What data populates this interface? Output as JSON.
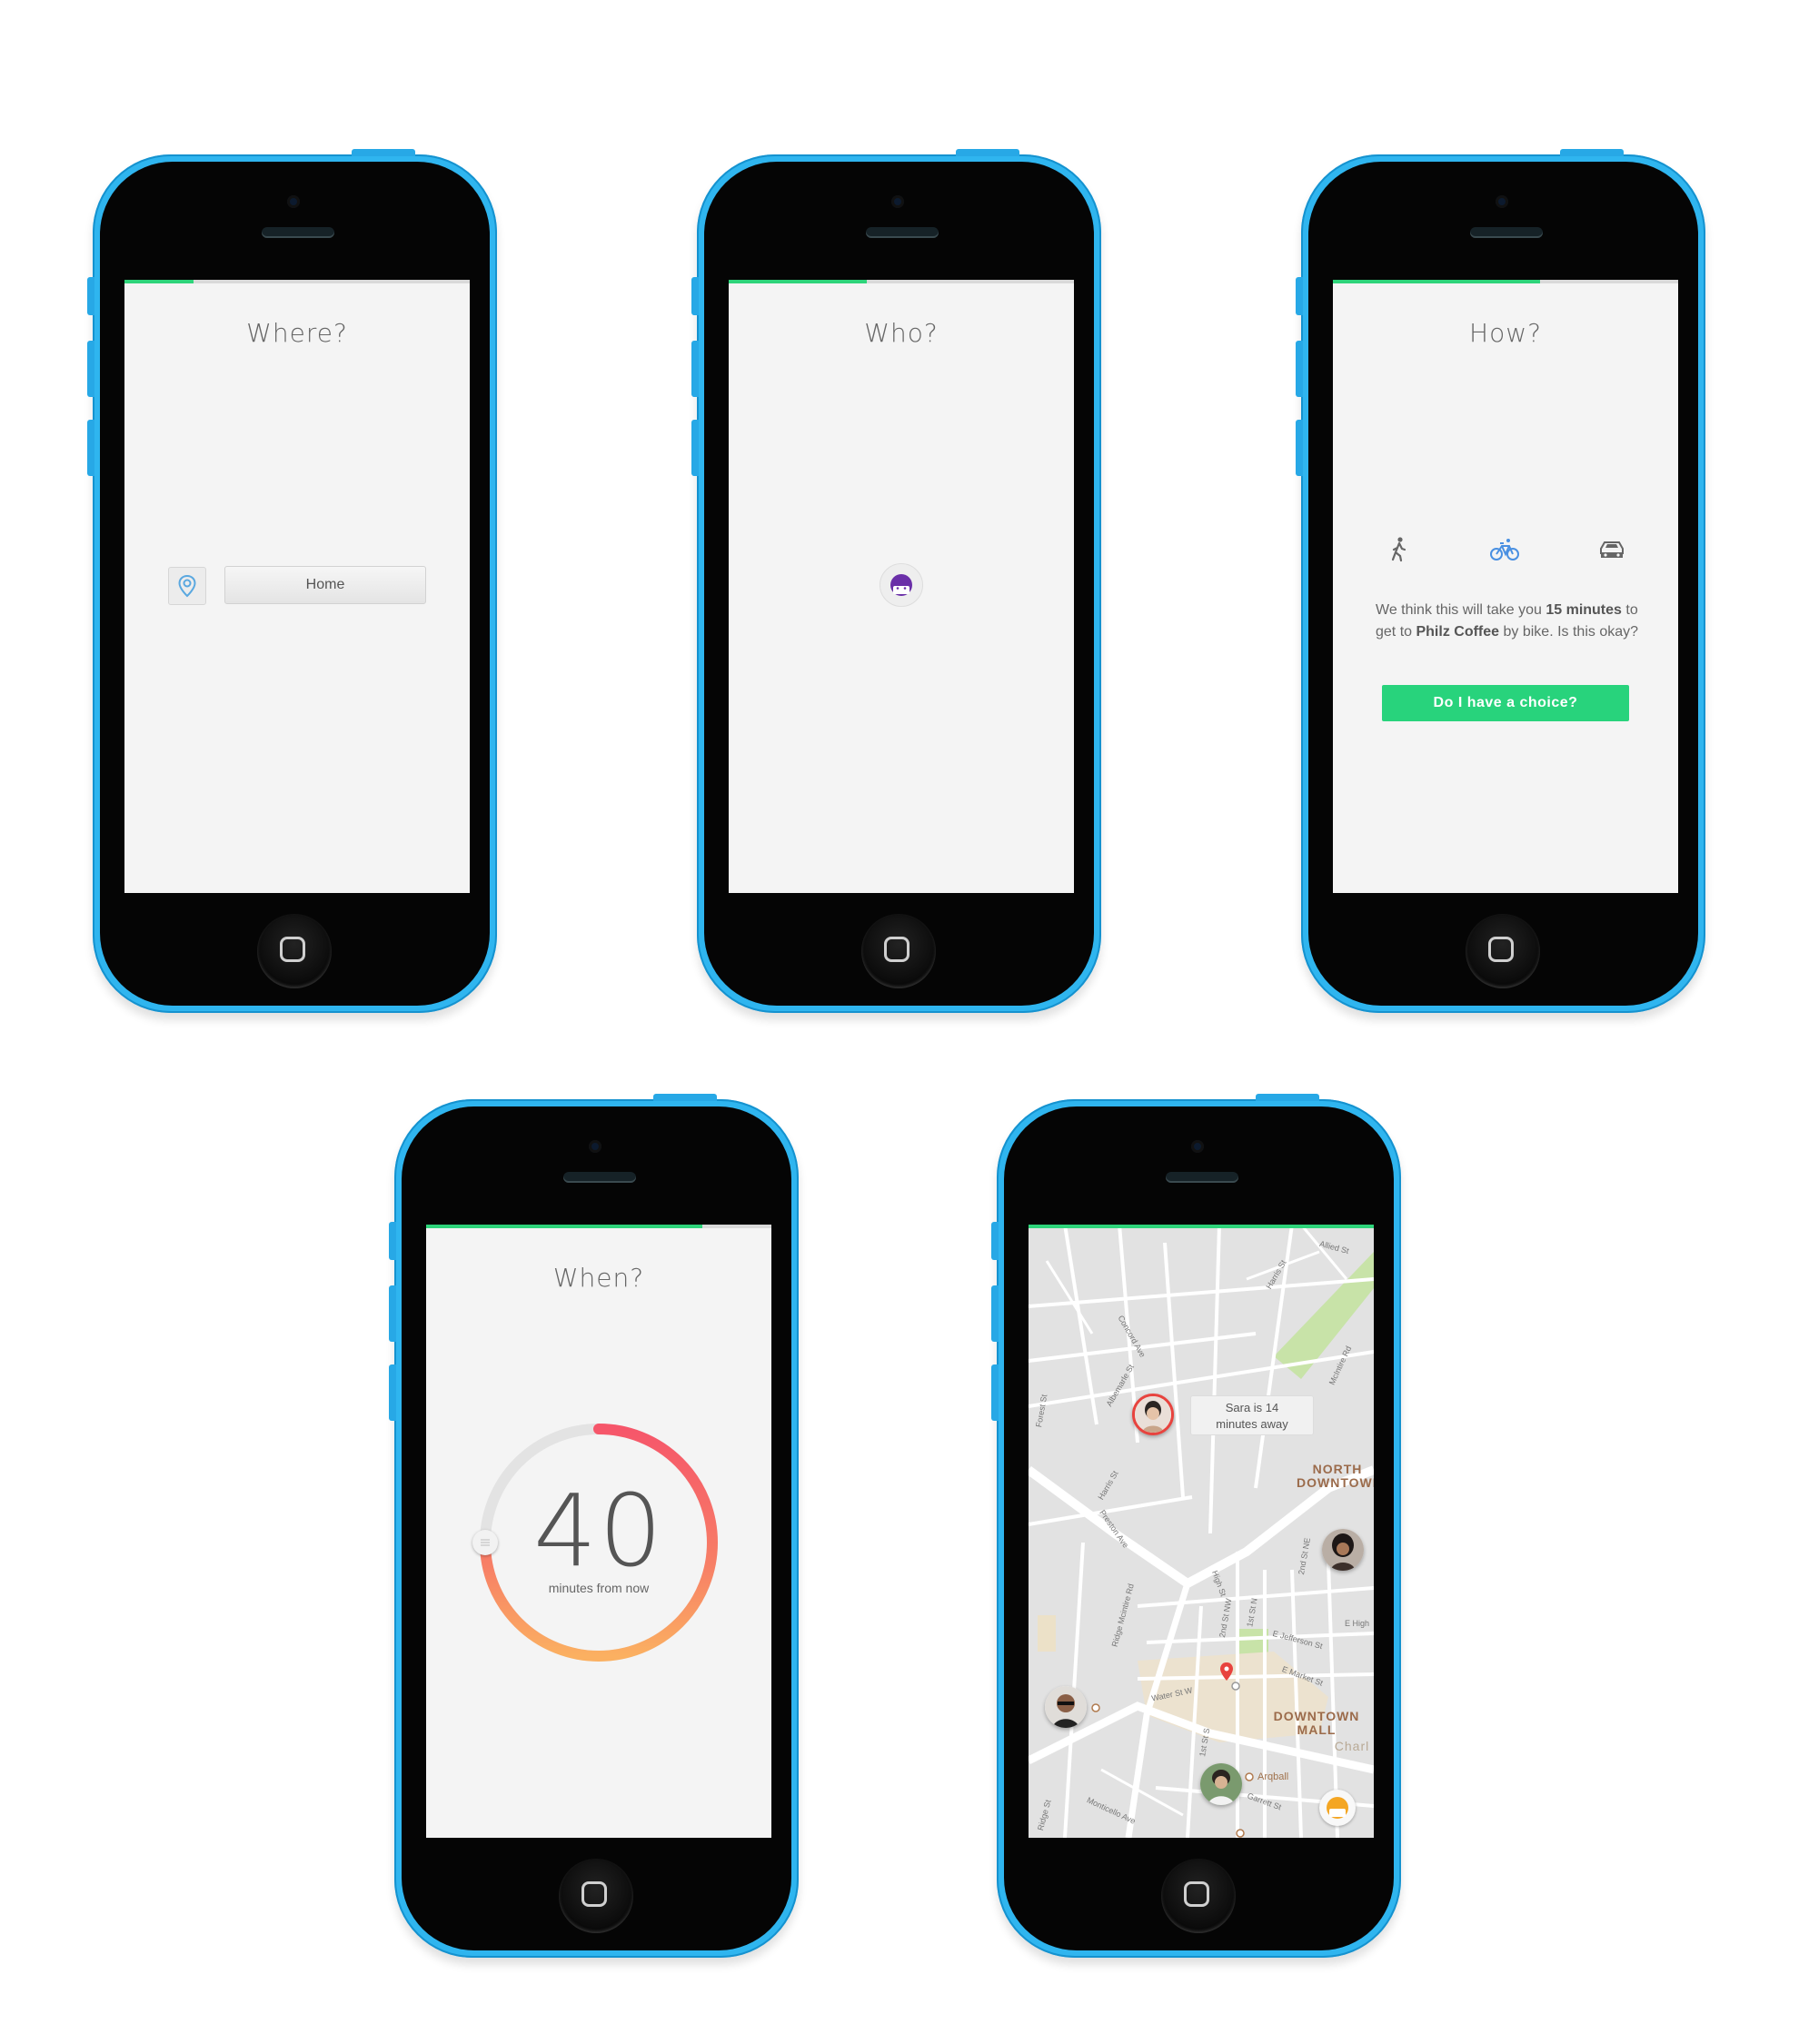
{
  "screens": {
    "where": {
      "title": "Where?",
      "location_field": "Home",
      "progress": 0.2
    },
    "who": {
      "title": "Who?",
      "progress": 0.4
    },
    "how": {
      "title": "How?",
      "progress": 0.6,
      "modes": [
        "walk-icon",
        "bike-icon",
        "car-icon"
      ],
      "selected_mode": "bike",
      "message_pre": "We think this will take you ",
      "message_minutes": "15 minutes",
      "message_mid": " to get to ",
      "message_place": "Philz Coffee",
      "message_post": " by bike. Is this okay?",
      "button_label": "Do I have a choice?"
    },
    "when": {
      "title": "When?",
      "minutes": "40",
      "subtitle": "minutes from now",
      "progress": 0.8,
      "dial_fraction": 0.66
    },
    "map": {
      "progress": 1.0,
      "tooltip": "Sara is 14 minutes away",
      "area_labels": [
        "NORTH DOWNTOWN",
        "DOWNTOWN MALL"
      ],
      "place_label": "Arqball",
      "partial_label": "Charl",
      "streets": [
        "Concord Ave",
        "Albemarle St",
        "Harris St",
        "Preston Ave",
        "Forest St",
        "Ridge Mcintire Rd",
        "High St",
        "2nd St NW",
        "1st St N",
        "E Jefferson St",
        "E Market St",
        "Water St W",
        "1st St S",
        "Monticello Ave",
        "Garrett St",
        "2nd St NE",
        "McIntire Rd",
        "E High",
        "Ridge St",
        "Allied St",
        "Harris St"
      ]
    }
  },
  "colors": {
    "phone_shell": "#2fb5ef",
    "accent_green": "#2ed47a",
    "dial_red": "#f6566a",
    "dial_orange": "#fbb061",
    "pin_red": "#e8433e"
  }
}
